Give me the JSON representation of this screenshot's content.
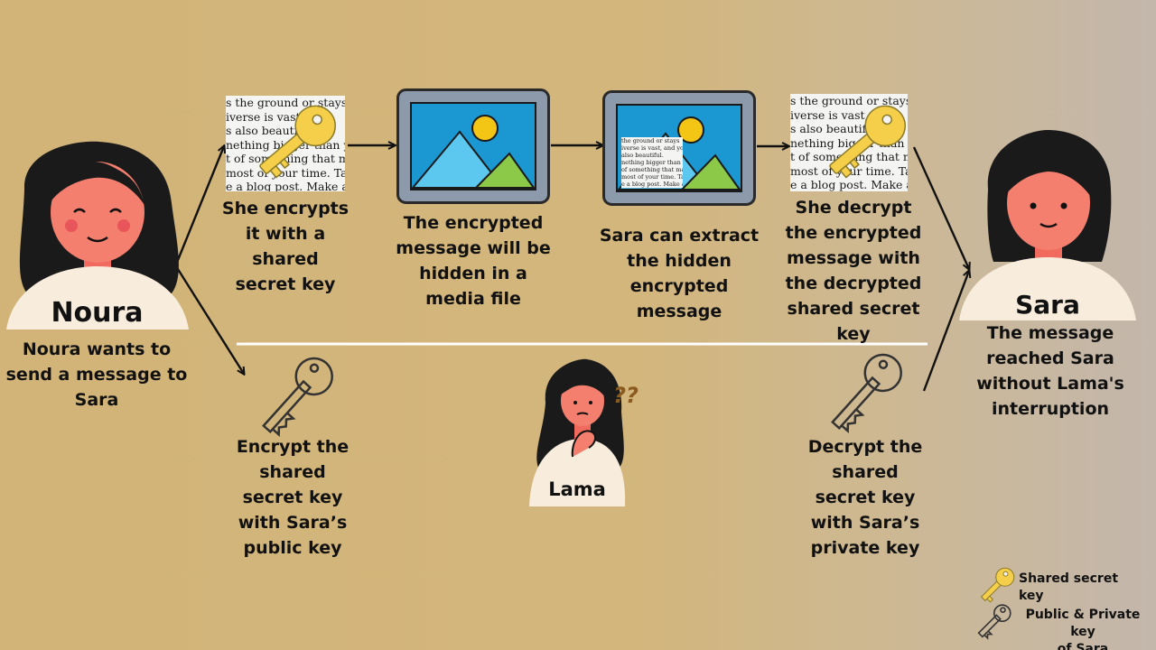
{
  "people": {
    "noura": {
      "name": "Noura",
      "caption": "Noura wants to\nsend a message to\nSara"
    },
    "sara": {
      "name": "Sara",
      "caption": "The message\nreached Sara\nwithout Lama's\ninterruption"
    },
    "lama": {
      "name": "Lama",
      "thought": "??"
    }
  },
  "steps": {
    "encrypt": "She encrypts\nit with a\nshared\nsecret key",
    "hide": "The encrypted\nmessage will be\nhidden in a\nmedia file",
    "extract": "Sara can extract\nthe hidden\nencrypted message",
    "decrypt": "She decrypt\nthe encrypted\nmessage with\nthe decrypted\nshared secret\nkey"
  },
  "key_exchange": {
    "encrypt_key": "Encrypt the\nshared\nsecret key\nwith Sara’s\npublic key",
    "decrypt_key": "Decrypt the\nshared\nsecret key\nwith Sara’s\nprivate key"
  },
  "document_text": {
    "left": [
      "s the ground or stays",
      "iverse is vast, and",
      "s also beautiful",
      "nething bigger than you",
      "t of something that ma",
      "most of your time. Tal",
      "e a blog post. Make a"
    ],
    "right": [
      "s the ground or stays",
      "iverse is vast, and",
      "s also beautiful",
      "nething bigger than",
      "t of something that ma",
      "most of your time. Tal",
      "e a blog post. Make a"
    ],
    "embedded": [
      "the ground or stays",
      "iverse is vast, and you",
      "also beautiful.",
      "nething bigger than y",
      "of something that ma",
      "most of your time. Tal",
      "e a blog post. Make a"
    ]
  },
  "legend": {
    "shared": "Shared secret key",
    "public_private": "Public & Private key\nof Sara"
  },
  "colors": {
    "background": "#d2b478",
    "skin": "#f47f6e",
    "hair": "#1a1a1a",
    "shirt": "#f8ecdc",
    "gold_key": "#f5cf4a",
    "frame": "#8d9aac",
    "sky": "#1b98d1",
    "mountain_blue": "#5cc8ef",
    "mountain_green": "#8cc949",
    "sun": "#f3c514"
  },
  "icons": [
    "gold-key-icon",
    "outline-key-icon",
    "image-icon",
    "arrow-icon"
  ]
}
